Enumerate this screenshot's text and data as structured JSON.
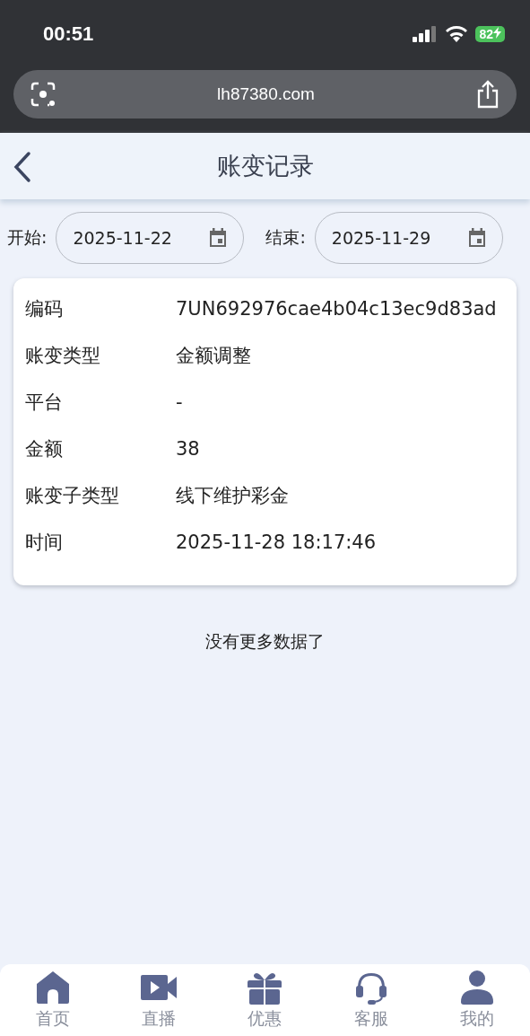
{
  "status_bar": {
    "time": "00:51",
    "battery": "82"
  },
  "browser": {
    "url": "lh87380.com"
  },
  "header": {
    "title": "账变记录"
  },
  "filters": [
    {
      "label": "开始:",
      "value": "2025-11-22"
    },
    {
      "label": "结束:",
      "value": "2025-11-29"
    }
  ],
  "record": [
    {
      "label": "编码",
      "value": "7UN692976cae4b04c13ec9d83ad"
    },
    {
      "label": "账变类型",
      "value": "金额调整"
    },
    {
      "label": "平台",
      "value": "-"
    },
    {
      "label": "金额",
      "value": "38"
    },
    {
      "label": "账变子类型",
      "value": "线下维护彩金"
    },
    {
      "label": "时间",
      "value": "2025-11-28 18:17:46"
    }
  ],
  "footer_note": "没有更多数据了",
  "tab_bar": [
    {
      "label": "首页",
      "kind": "home"
    },
    {
      "label": "直播",
      "kind": "video"
    },
    {
      "label": "优惠",
      "kind": "gift"
    },
    {
      "label": "客服",
      "kind": "headset"
    },
    {
      "label": "我的",
      "kind": "user"
    }
  ]
}
